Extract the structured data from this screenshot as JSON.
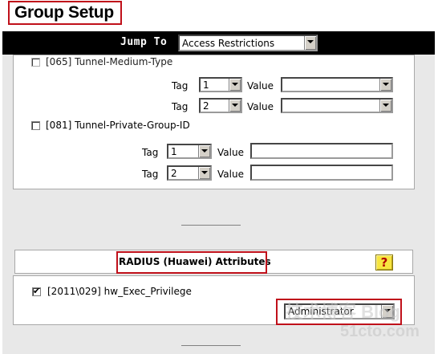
{
  "header": {
    "title": "Group Setup"
  },
  "jump": {
    "label": "Jump To",
    "selected": "Access Restrictions"
  },
  "tunnel_medium_type": {
    "label": "[065] Tunnel-Medium-Type",
    "rows": [
      {
        "tag_label": "Tag",
        "tag_value": "1",
        "value_label": "Value",
        "value": ""
      },
      {
        "tag_label": "Tag",
        "tag_value": "2",
        "value_label": "Value",
        "value": ""
      }
    ]
  },
  "tunnel_private_group": {
    "label": "[081] Tunnel-Private-Group-ID",
    "rows": [
      {
        "tag_label": "Tag",
        "tag_value": "1",
        "value_label": "Value",
        "value": ""
      },
      {
        "tag_label": "Tag",
        "tag_value": "2",
        "value_label": "Value",
        "value": ""
      }
    ]
  },
  "radius_section": {
    "title": "RADIUS (Huawei) Attributes",
    "help_glyph": "?",
    "attribute_label": "[2011\\029] hw_Exec_Privilege",
    "attribute_checked": true,
    "privilege_selected": "Administrator"
  },
  "watermark": {
    "line1": "51cto.com",
    "line2": "技术博客 Blog"
  },
  "colors": {
    "highlight_red": "#c0101a",
    "jump_bar": "#000000",
    "page_background": "#e8e8e8",
    "help_icon": "#f7e53f"
  }
}
